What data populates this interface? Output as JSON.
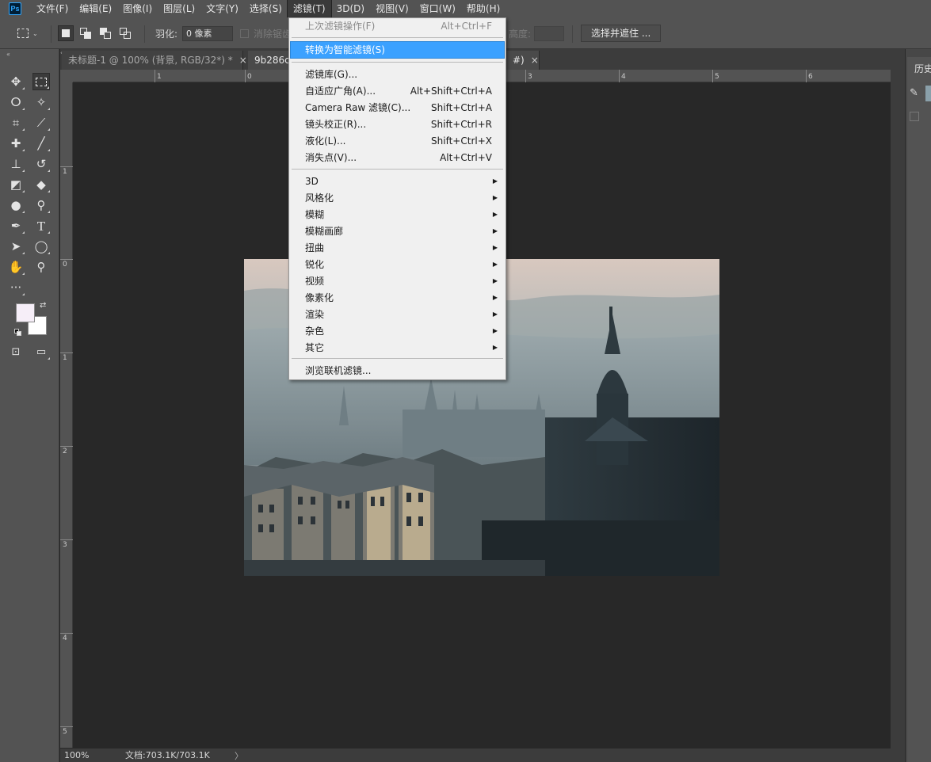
{
  "app": {
    "logo": "Ps"
  },
  "menubar": {
    "items": [
      "文件(F)",
      "编辑(E)",
      "图像(I)",
      "图层(L)",
      "文字(Y)",
      "选择(S)",
      "滤镜(T)",
      "3D(D)",
      "视图(V)",
      "窗口(W)",
      "帮助(H)"
    ],
    "open_item": "滤镜(T)"
  },
  "options": {
    "feather_label": "羽化:",
    "feather_value": "0 像素",
    "antialias_label": "消除锯齿",
    "height_label": "高度:",
    "select_mask_button": "选择并遮住 ..."
  },
  "tabs": [
    {
      "label": "未标题-1 @ 100% (背景, RGB/32*) *",
      "close": "×"
    },
    {
      "label": "9b286c",
      "close": "×"
    },
    {
      "label": "#)",
      "close": "×"
    }
  ],
  "ruler": {
    "h_ticks": [
      "1",
      "0",
      "1",
      "2",
      "3",
      "4",
      "5",
      "6"
    ],
    "v_ticks": [
      "1",
      "0",
      "1",
      "2",
      "3",
      "4",
      "5"
    ]
  },
  "status": {
    "zoom": "100%",
    "doc_info": "文档:703.1K/703.1K",
    "arrow": "〉"
  },
  "right_panel": {
    "title": "历史"
  },
  "filter_menu": {
    "items": [
      {
        "label": "上次滤镜操作(F)",
        "shortcut": "Alt+Ctrl+F",
        "disabled": true
      },
      {
        "label": "转换为智能滤镜(S)",
        "shortcut": "",
        "highlighted": true
      },
      {
        "label": "滤镜库(G)...",
        "shortcut": ""
      },
      {
        "label": "自适应广角(A)...",
        "shortcut": "Alt+Shift+Ctrl+A"
      },
      {
        "label": "Camera Raw 滤镜(C)...",
        "shortcut": "Shift+Ctrl+A"
      },
      {
        "label": "镜头校正(R)...",
        "shortcut": "Shift+Ctrl+R"
      },
      {
        "label": "液化(L)...",
        "shortcut": "Shift+Ctrl+X"
      },
      {
        "label": "消失点(V)...",
        "shortcut": "Alt+Ctrl+V"
      },
      {
        "label": "3D",
        "submenu": true
      },
      {
        "label": "风格化",
        "submenu": true
      },
      {
        "label": "模糊",
        "submenu": true
      },
      {
        "label": "模糊画廊",
        "submenu": true
      },
      {
        "label": "扭曲",
        "submenu": true
      },
      {
        "label": "锐化",
        "submenu": true
      },
      {
        "label": "视频",
        "submenu": true
      },
      {
        "label": "像素化",
        "submenu": true
      },
      {
        "label": "渲染",
        "submenu": true
      },
      {
        "label": "杂色",
        "submenu": true
      },
      {
        "label": "其它",
        "submenu": true
      },
      {
        "label": "浏览联机滤镜...",
        "shortcut": ""
      }
    ]
  },
  "colors": {
    "foreground": "#f6eef8",
    "background": "#ffffff",
    "highlight": "#3ba1ff",
    "panel": "#535353",
    "canvas": "#282828"
  }
}
